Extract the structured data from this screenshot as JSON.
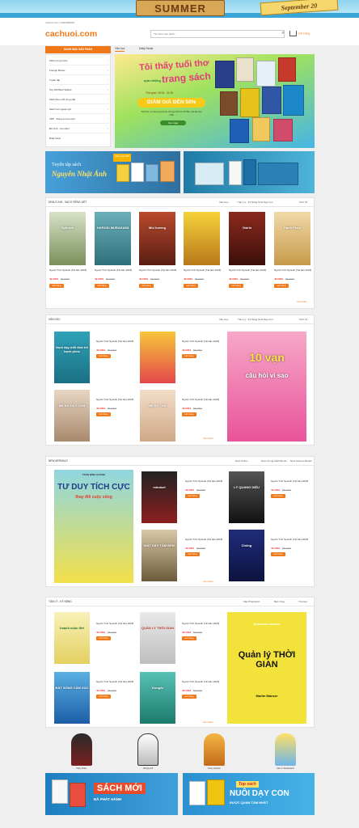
{
  "top_banner": {
    "summer": "SUMMER",
    "date": "September 20"
  },
  "header": {
    "contact": "cachuoi.com    |    0943698939",
    "logo": "cachuoi.com",
    "search_placeholder": "Tìm kiếm sản phẩm",
    "cart_label": "Giỏ hàng"
  },
  "nav": {
    "category_button": "DANH MỤC SẢN PHẨM",
    "tabs": [
      "Văn học",
      "Daily Deals"
    ]
  },
  "sidebar": {
    "items": [
      "Sách trong nước",
      "Foreign Books",
      "Tuyển tập",
      "Top 100 Best Sellers",
      "Sách theo chủ cung cấp",
      "Sách học ngoại ngữ",
      "VPP - Dụng cụ học sinh",
      "Đồ chơi - lưu niệm",
      "Daily Deal"
    ]
  },
  "hero": {
    "line1": "Tôi thấy tuổi thơ",
    "line2": "qua những",
    "line3": "trang sách",
    "period": "Thời gian: 28.06 - 31.08",
    "discount": "GIẢM GIÁ ĐẾN 50%",
    "note": "Tuổi thơ, ai cũng từng là bé nhưng tuổi thơ chỉ đến một lần duy nhất",
    "cta": "Xem ngay"
  },
  "promo": {
    "line1": "Tuyển tập sách",
    "line2": "Nguyễn Nhật Ánh",
    "badge": "Giảm giá 25%"
  },
  "sections": {
    "deals": {
      "title": "DEALS 24H - SÁCH TIẾNG VIỆT",
      "tabs": [
        "Văn Học",
        "Tâm Lý - Kỹ Năng Nuôi Dạy Con",
        "Kinh Tế"
      ],
      "products": [
        {
          "cover": "Spinoza",
          "title": "Người Tình Spoinik (Tái bản 2018)",
          "price": "49.000đ",
          "old": "55.000đ",
          "buy": "Giỏ hàng"
        },
        {
          "cover": "HARUKI MURAKAMI",
          "title": "Người Tình Spoinik (Tái bản 2018)",
          "price": "49.000đ",
          "old": "55.000đ",
          "buy": "Giỏ hàng"
        },
        {
          "cover": "Mùi hương",
          "title": "Người Tình Spoinik (Tái bản 2018)",
          "price": "49.000đ",
          "old": "55.000đ",
          "buy": "Giỏ hàng"
        },
        {
          "cover": "",
          "title": "Người Tình Spoinik (Tái bản 2018)",
          "price": "49.000đ",
          "old": "55.000đ",
          "buy": "Giỏ hàng"
        },
        {
          "cover": "Osiris",
          "title": "Người Tình Spoinik (Tái bản 2018)",
          "price": "49.000đ",
          "old": "55.000đ",
          "buy": "Giỏ hàng"
        },
        {
          "cover": "Hạnh Phúc",
          "title": "Người Tình Spoinik (Tái bản 2018)",
          "price": "49.000đ",
          "old": "55.000đ",
          "buy": "Giỏ hàng"
        }
      ],
      "more": "Xem thêm"
    },
    "vanhoc": {
      "title": "VĂN HỌC",
      "tabs": [
        "Văn Học",
        "Tâm Lý - Kỹ Năng Nuôi Dạy Con",
        "Kinh Tế"
      ],
      "products": [
        {
          "cover": "Nuôi dạy mỗi đứa trẻ hạnh phúc",
          "title": "Người Tình Spoinik (Tái bản 2018)",
          "price": "49.000đ",
          "old": "55.000đ",
          "buy": "Giỏ hàng"
        },
        {
          "cover": "",
          "title": "Người Tình Spoinik (Tái bản 2018)",
          "price": "49.000đ",
          "old": "55.000đ",
          "buy": "Giỏ hàng"
        },
        {
          "cover": "MẸ ĐÓ DẠY CON",
          "title": "Người Tình Spoinik (Tái bản 2018)",
          "price": "49.000đ",
          "old": "55.000đ",
          "buy": "Giỏ hàng"
        },
        {
          "cover": "MẸ ĐÓ THÁI",
          "title": "Người Tình Spoinik (Tái bản 2018)",
          "price": "49.000đ",
          "old": "55.000đ",
          "buy": "Giỏ hàng"
        }
      ],
      "feature": {
        "big": "10 vạn",
        "sub": "câu hỏi vì sao"
      },
      "more": "Xem thêm"
    },
    "arrivals": {
      "title": "NEW ARRIVALS",
      "tabs": [
        "New Fiction",
        "New Young Adult Books",
        "New Science Books"
      ],
      "feature": {
        "author": "TRẦN ĐÌNH HOÀNH",
        "big": "TƯ DUY TÍCH CỰC",
        "sub": "thay đổi cuộc sống"
      },
      "products": [
        {
          "cover": "mindset",
          "title": "Người Tình Spoinik (Tái bản 2018)",
          "price": "49.000đ",
          "old": "55.000đ",
          "buy": "Giỏ hàng"
        },
        {
          "cover": "LÝ QUANG DIỆU",
          "title": "Người Tình Spoinik (Tái bản 2018)",
          "price": "49.000đ",
          "old": "55.000đ",
          "buy": "Giỏ hàng"
        },
        {
          "cover": "MẶT DÀY TÂM ĐEN",
          "title": "Người Tình Spoinik (Tái bản 2018)",
          "price": "49.000đ",
          "old": "55.000đ",
          "buy": "Giỏ hàng"
        },
        {
          "cover": "Chống",
          "title": "Người Tình Spoinik (Tái bản 2018)",
          "price": "49.000đ",
          "old": "55.000đ",
          "buy": "Giỏ hàng"
        }
      ],
      "more": "Xem thêm"
    },
    "tamly": {
      "title": "TÂM LÝ - KỸ NĂNG",
      "tabs": [
        "Sắp Phát Hành",
        "Bán Chạy",
        "Trả Góp"
      ],
      "products": [
        {
          "cover": "hoạch cuộc đời",
          "title": "Người Tình Spoinik (Tái bản 2018)",
          "price": "49.000đ",
          "old": "55.000đ",
          "buy": "Giỏ hàng"
        },
        {
          "cover": "QUẢN LÝ THỜI GIAN",
          "title": "Người Tình Spoinik (Tái bản 2018)",
          "price": "49.000đ",
          "old": "55.000đ",
          "buy": "Giỏ hàng"
        },
        {
          "cover": "BẮT SÓNG CẢM XÚC",
          "title": "Người Tình Spoinik (Tái bản 2018)",
          "price": "49.000đ",
          "old": "55.000đ",
          "buy": "Giỏ hàng"
        },
        {
          "cover": "Kungfu",
          "title": "Người Tình Spoinik (Tái bản 2018)",
          "price": "49.000đ",
          "old": "55.000đ",
          "buy": "Giỏ hàng"
        }
      ],
      "feature": {
        "small": "business secrets",
        "big": "Quản lý THỜI GIAN",
        "author": "Martin Manser"
      },
      "more": "Xem thêm"
    }
  },
  "mascots": [
    "Harry Potter",
    "Whopsy Elf",
    "Percy Jackson",
    "Alice in Wonderland"
  ],
  "bottom_banners": {
    "left_big": "SÁCH MỚI",
    "left_sub": "ĐÃ PHÁT HÀNH",
    "right_tag": "Top sách",
    "right_big": "NUÔI DẠY CON",
    "right_sub": "ĐƯỢC QUAN TÂM NHẤT"
  },
  "colors": {
    "accent": "#f07818",
    "price": "#e53935"
  }
}
